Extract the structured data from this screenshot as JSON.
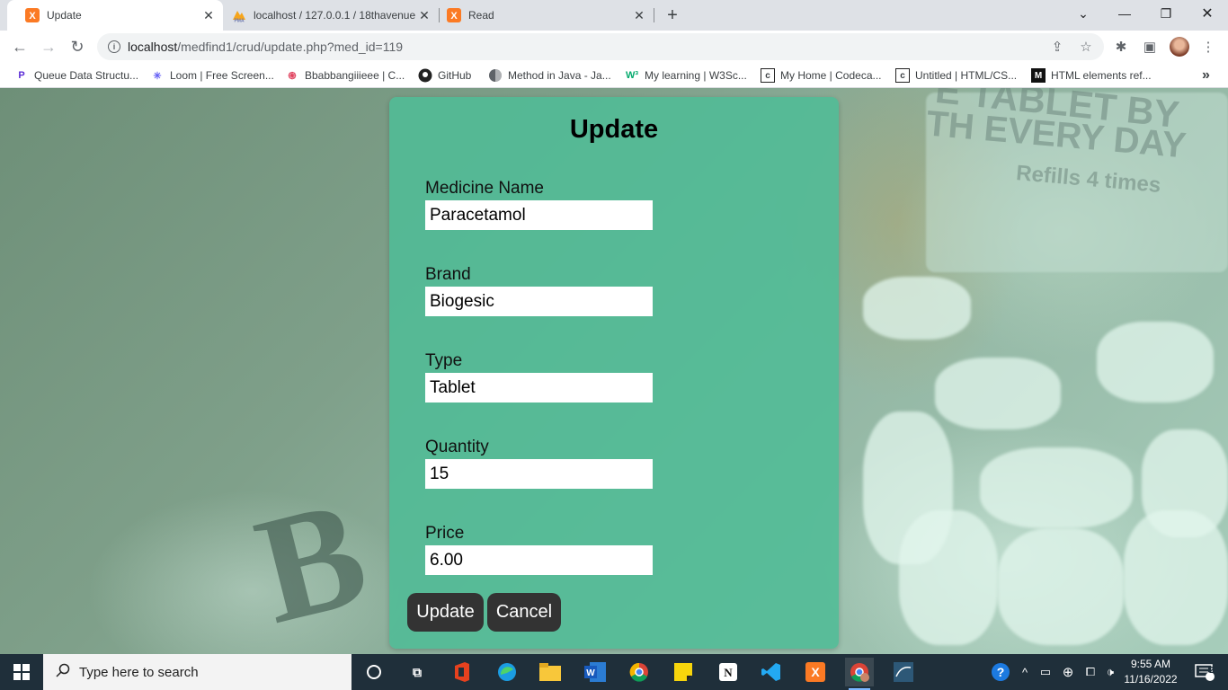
{
  "browser": {
    "tabs": [
      {
        "title": "Update",
        "icon": "xampp-icon"
      },
      {
        "title": "localhost / 127.0.0.1 / 18thavenue",
        "icon": "phpmyadmin-icon"
      },
      {
        "title": "Read",
        "icon": "xampp-icon"
      }
    ],
    "address": {
      "host": "localhost",
      "path": "/medfind1/crud/update.php?med_id=119"
    },
    "bookmarks": [
      {
        "label": "Queue Data Structu...",
        "icon": "p-icon"
      },
      {
        "label": "Loom | Free Screen...",
        "icon": "loom-icon"
      },
      {
        "label": "Bbabbangiiieee | C...",
        "icon": "openai-icon"
      },
      {
        "label": "GitHub",
        "icon": "github-icon"
      },
      {
        "label": "Method in Java - Ja...",
        "icon": "globe-icon"
      },
      {
        "label": "My learning | W3Sc...",
        "icon": "w3schools-icon"
      },
      {
        "label": "My Home | Codeca...",
        "icon": "codecademy-icon"
      },
      {
        "label": "Untitled | HTML/CS...",
        "icon": "codecademy-icon"
      },
      {
        "label": "HTML elements ref...",
        "icon": "mdn-icon"
      }
    ],
    "more_bookmarks": "»"
  },
  "form": {
    "title": "Update",
    "fields": [
      {
        "label": "Medicine Name",
        "value": "Paracetamol"
      },
      {
        "label": "Brand",
        "value": "Biogesic"
      },
      {
        "label": "Type",
        "value": "Tablet"
      },
      {
        "label": "Quantity",
        "value": "15"
      },
      {
        "label": "Price",
        "value": "6.00"
      }
    ],
    "update_label": "Update",
    "cancel_label": "Cancel"
  },
  "background": {
    "bottle_line1": "E TABLET BY",
    "bottle_line2": "TH EVERY DAY",
    "bottle_line3": "Refills 4 times",
    "paper_letter": "B"
  },
  "taskbar": {
    "search_placeholder": "Type here to search",
    "time": "9:55 AM",
    "date": "11/16/2022",
    "notification_count": "2"
  },
  "colors": {
    "card": "#50bc96",
    "button": "#333333",
    "taskbar": "#1f2f3a"
  }
}
